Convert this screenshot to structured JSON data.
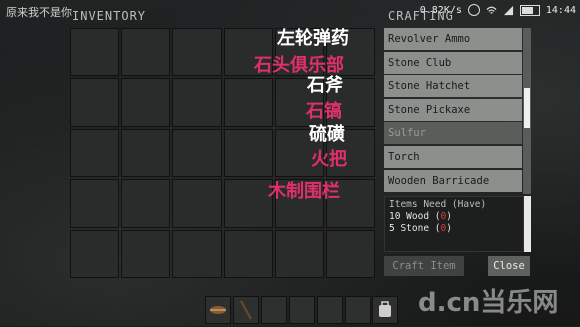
{
  "status_bar": {
    "left_text": "原来我不是你",
    "speed": "0.82K/s",
    "time": "14:44"
  },
  "inventory": {
    "title": "INVENTORY"
  },
  "crafting": {
    "title": "CRAFTING",
    "items": [
      {
        "label": "Revolver Ammo"
      },
      {
        "label": "Stone Club"
      },
      {
        "label": "Stone Hatchet"
      },
      {
        "label": "Stone Pickaxe"
      },
      {
        "label": "Sulfur"
      },
      {
        "label": "Torch"
      },
      {
        "label": "Wooden Barricade"
      }
    ],
    "selected_index": 4,
    "requirements": {
      "header": "Items Need (Have)",
      "lines": [
        {
          "text": "10 Wood ",
          "have": "0"
        },
        {
          "text": "5 Stone ",
          "have": "0"
        }
      ]
    },
    "craft_label": "Craft Item",
    "close_label": "Close"
  },
  "overlay_labels": [
    {
      "text": "左轮弹药",
      "color": "#ffffff"
    },
    {
      "text": "石头俱乐部",
      "color": "#e0306c"
    },
    {
      "text": "石斧",
      "color": "#ffffff"
    },
    {
      "text": "石镐",
      "color": "#e0306c"
    },
    {
      "text": "硫磺",
      "color": "#ffffff"
    },
    {
      "text": "火把",
      "color": "#e0306c"
    },
    {
      "text": "木制围栏",
      "color": "#e0306c"
    }
  ],
  "hotbar": {
    "slot_count": 6,
    "items": [
      "arrow-icon",
      "bow-icon"
    ]
  },
  "watermark": "d.cn当乐网",
  "colors": {
    "accent_red": "#e03c3c",
    "overlay_pink": "#e0306c"
  }
}
